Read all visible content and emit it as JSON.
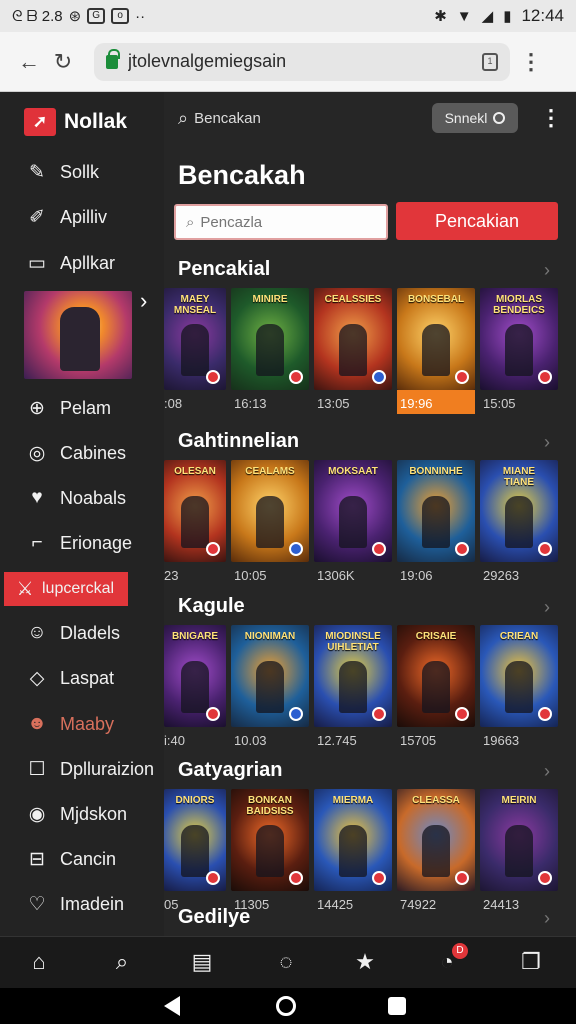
{
  "status_bar": {
    "left_text": "ᘓ ᗷ 2.8",
    "time": "12:44",
    "icons": [
      "gear-icon",
      "cast-icon",
      "notification-icon",
      "bluetooth-icon",
      "wifi-icon",
      "signal-icon",
      "battery-icon"
    ]
  },
  "browser": {
    "url": "jtolevnalgemiegsain",
    "icons": [
      "back-arrow-icon",
      "reload-icon",
      "lock-icon",
      "tabs-icon",
      "kebab-menu-icon"
    ]
  },
  "sidebar": {
    "brand": "Nollak",
    "items": [
      {
        "label": "Sollk",
        "icon": "brush-icon"
      },
      {
        "label": "Apilliv",
        "icon": "tag-icon"
      },
      {
        "label": "Apllkar",
        "icon": "card-icon"
      },
      {
        "label": "Pelam",
        "icon": "soccer-ball-icon"
      },
      {
        "label": "Cabines",
        "icon": "refresh-icon"
      },
      {
        "label": "Noabals",
        "icon": "heart-icon"
      },
      {
        "label": "Erionage",
        "icon": "document-icon"
      },
      {
        "label": "lupcerckal",
        "icon": "swords-icon"
      },
      {
        "label": "Dladels",
        "icon": "chat-icon"
      },
      {
        "label": "Laspat",
        "icon": "tag-icon"
      },
      {
        "label": "Maaby",
        "icon": "mask-icon"
      },
      {
        "label": "Dplluraizion",
        "icon": "square-icon"
      },
      {
        "label": "Mjdskon",
        "icon": "circle-icon"
      },
      {
        "label": "Cancin",
        "icon": "briefcase-icon"
      },
      {
        "label": "Imadein",
        "icon": "heart-outline-icon"
      }
    ]
  },
  "main": {
    "search_label": "Bencakan",
    "pill_label": "Snnekl",
    "title": "Bencakah",
    "search_placeholder": "Pencazla",
    "search_button": "Pencakian",
    "sections": [
      {
        "title": "Pencakial",
        "tiles": [
          {
            "title": "MAEY\nMNSEAL",
            "caption": ":08"
          },
          {
            "title": "MINIRE",
            "caption": "16:13"
          },
          {
            "title": "CEALSSIES",
            "caption": "13:05"
          },
          {
            "title": "BONSEBAL",
            "caption": "19:96"
          },
          {
            "title": "MIORLAS\nBENDEICS",
            "caption": "15:05"
          }
        ]
      },
      {
        "title": "Gahtinnelian",
        "tiles": [
          {
            "title": "OLESAN",
            "caption": "23"
          },
          {
            "title": "CEALAMS",
            "caption": "10:05"
          },
          {
            "title": "MOKSAAT",
            "caption": "1306K"
          },
          {
            "title": "BONNINHE",
            "caption": "19:06"
          },
          {
            "title": "MIANE\nTIANE",
            "caption": "29263"
          }
        ]
      },
      {
        "title": "Kagule",
        "tiles": [
          {
            "title": "BNIGARE",
            "caption": "i:40"
          },
          {
            "title": "NIONIMAN",
            "caption": "10.03"
          },
          {
            "title": "MIODINSLE\nUIHLETIAT",
            "caption": "12.745"
          },
          {
            "title": "CRISAIE",
            "caption": "15705"
          },
          {
            "title": "CRIEAN",
            "caption": "19663"
          }
        ]
      },
      {
        "title": "Gatyagrian",
        "tiles": [
          {
            "title": "DNIORS",
            "caption": "05"
          },
          {
            "title": "BONKAN\nBAIDSISS",
            "caption": "11305"
          },
          {
            "title": "MIERMA",
            "caption": "14425"
          },
          {
            "title": "CLEASSA",
            "caption": "74922"
          },
          {
            "title": "MEIRIN",
            "caption": "24413"
          }
        ]
      },
      {
        "title": "Gedilye",
        "tiles": []
      }
    ]
  },
  "app_nav": {
    "icons": [
      "home-icon",
      "search-icon",
      "library-icon",
      "chat-bubble-icon",
      "star-icon",
      "notifications-icon",
      "pages-icon"
    ],
    "badge": "D"
  },
  "colors": {
    "accent": "#e1363a",
    "highlight": "#f07e20"
  }
}
